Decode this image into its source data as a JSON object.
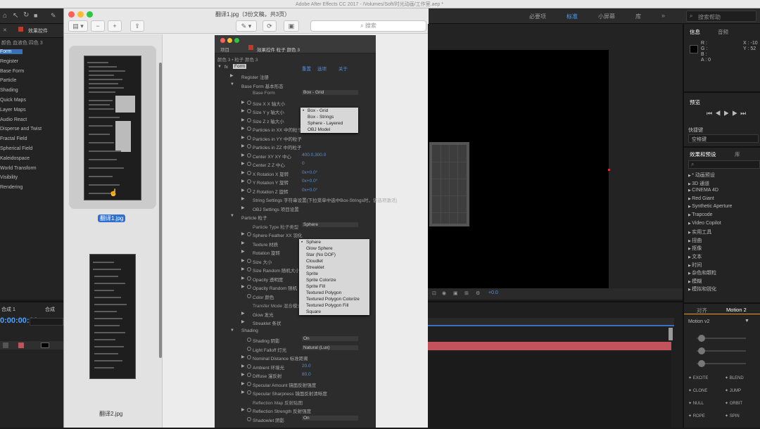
{
  "ae": {
    "window_title": "Adobe After Effects CC 2017 - /Volumes/Soft/时光动画/工作室.aep *",
    "workspaces": [
      "必要项",
      "标准",
      "小屏幕",
      "库"
    ],
    "search_placeholder": "搜索帮助",
    "left": {
      "tab_label": "效果控件",
      "comp_path": "颜色 血液色 四色 3",
      "items": [
        "Form",
        "Register",
        "Base Form",
        "Particle",
        "Shading",
        "Quick Maps",
        "Layer Maps",
        "Audio React",
        "Disperse and Twist",
        "Fractal Field",
        "Spherical Field",
        "Kaleidospace",
        "World Transform",
        "Visibility",
        "Rendering"
      ],
      "bottom_tab": "合成 1",
      "timecode": "0:00:00:00",
      "bottom_tab2": "合成"
    },
    "comp_footer_value": "+0.0",
    "right": {
      "info_tab": "信息",
      "audio_tab": "音频",
      "info_lines": [
        "R :",
        "G :",
        "B :",
        "A : 0"
      ],
      "xy": [
        "X : -10",
        "Y : 52"
      ],
      "preview_title": "预览",
      "shortcut_label": "快捷键",
      "shortcut_value": "空格键",
      "effects_tab": "效果和预设",
      "lib_tab": "库",
      "effects": [
        "* 动画预设",
        "3D 通道",
        "CINEMA 4D",
        "Red Giant",
        "Synthetic Aperture",
        "Trapcode",
        "Video Copilot",
        "实用工具",
        "扭曲",
        "抠像",
        "文本",
        "时间",
        "杂色和颗粒",
        "模糊",
        "模拟和锐化"
      ],
      "align_tab": "对齐",
      "motion_tab": "Motion 2",
      "motion_dropdown": "Motion v2",
      "motion_buttons": [
        "EXCITE",
        "BLEND",
        "CLONE",
        "JUMP",
        "NULL",
        "ORBIT",
        "ROPE",
        "SPIN"
      ]
    }
  },
  "preview": {
    "title": "翻译1.jpg（3份文稿，共3页）",
    "search_placeholder": "搜索",
    "thumbs": [
      {
        "name": "翻译1.jpg",
        "selected": true
      },
      {
        "name": "翻译2.jpg",
        "selected": false
      }
    ]
  },
  "doc": {
    "tabs": [
      "项目",
      "效果控件 粒子 颜色 3"
    ],
    "breadcrumb": "颜色 3 • 粒子 颜色 3",
    "fx_name": "Form",
    "fx_buttons": [
      "重置",
      "选项",
      "关于"
    ],
    "rows": [
      {
        "label": "Register 注册",
        "indent": 2,
        "tri": true
      },
      {
        "label": "Base Form 基本形态",
        "indent": 2,
        "tri": true,
        "open": true
      },
      {
        "label": "Base Form",
        "indent": 4,
        "value": "Box - Grid"
      },
      {
        "label": "Size X  X 轴大小",
        "indent": 4,
        "tri": true,
        "sw": true
      },
      {
        "label": "Size Y  y 轴大小",
        "indent": 4,
        "tri": true,
        "sw": true
      },
      {
        "label": "Size Z  z 轴大小",
        "indent": 4,
        "tri": true,
        "sw": true
      },
      {
        "label": "Particles in XX 中的粒子",
        "indent": 4,
        "tri": true,
        "sw": true
      },
      {
        "label": "Particles in YY 中的粒子",
        "indent": 4,
        "tri": true,
        "sw": true
      },
      {
        "label": "Particles in ZZ 中的粒子",
        "indent": 4,
        "tri": true,
        "sw": true
      },
      {
        "label": "Center XY XY 中心",
        "indent": 4,
        "tri": true,
        "sw": true,
        "value": "400.0,300.0"
      },
      {
        "label": "Center Z  Z 中心",
        "indent": 4,
        "tri": true,
        "sw": true,
        "value": "0"
      },
      {
        "label": "X Rotation X 旋转",
        "indent": 4,
        "tri": true,
        "sw": true,
        "value": "0x+0.0°"
      },
      {
        "label": "Y Rotation Y 旋转",
        "indent": 4,
        "tri": true,
        "sw": true,
        "value": "0x+0.0°"
      },
      {
        "label": "Z Rotation Z 旋转",
        "indent": 4,
        "tri": true,
        "sw": true,
        "value": "0x+0.0°"
      },
      {
        "label": "String Settings 字符串设置(下拉菜单中选中Box-Strings时，该选项激活)",
        "indent": 4,
        "tri": true
      },
      {
        "label": "OBJ Settings 项目设置",
        "indent": 4,
        "tri": true
      },
      {
        "label": "Particle 粒子",
        "indent": 2,
        "tri": true,
        "open": true
      },
      {
        "label": "Particle Type 粒子类型",
        "indent": 4,
        "value": "Sphere"
      },
      {
        "label": "Sphere Feather XX 羽化",
        "indent": 4,
        "tri": true,
        "sw": true
      },
      {
        "label": "Texture 材质",
        "indent": 4,
        "tri": true
      },
      {
        "label": "Rotation 旋转",
        "indent": 4,
        "tri": true
      },
      {
        "label": "Size 大小",
        "indent": 4,
        "tri": true,
        "sw": true
      },
      {
        "label": "Size Random 随机大小",
        "indent": 4,
        "tri": true,
        "sw": true
      },
      {
        "label": "Opacity 透明度",
        "indent": 4,
        "tri": true,
        "sw": true
      },
      {
        "label": "Opacity Random 随机",
        "indent": 4,
        "tri": true,
        "sw": true
      },
      {
        "label": "Color 颜色",
        "indent": 4,
        "sw": true
      },
      {
        "label": "Transfer Mode 混合模式",
        "indent": 4
      },
      {
        "label": "Glow 发光",
        "indent": 4,
        "tri": true
      },
      {
        "label": "Streaklet 条状",
        "indent": 4,
        "tri": true
      },
      {
        "label": "Shading",
        "indent": 2,
        "tri": true,
        "open": true
      },
      {
        "label": "Shading 阴影",
        "indent": 4,
        "sw": true,
        "value": "On"
      },
      {
        "label": "Light Falloff 灯光",
        "indent": 4,
        "sw": true,
        "value": "Natural (Lux)"
      },
      {
        "label": "Nominal Distance 标准距离",
        "indent": 4,
        "tri": true,
        "sw": true
      },
      {
        "label": "Ambient 环境光",
        "indent": 4,
        "tri": true,
        "sw": true,
        "value": "20.0"
      },
      {
        "label": "Diffuse 漫反射",
        "indent": 4,
        "tri": true,
        "sw": true,
        "value": "80.0"
      },
      {
        "label": "Specular Amount 镜面反射强度",
        "indent": 4,
        "tri": true,
        "sw": true
      },
      {
        "label": "Specular Sharpness 镜面反射清晰度",
        "indent": 4,
        "tri": true,
        "sw": true
      },
      {
        "label": "Reflection Map 反射贴图",
        "indent": 4
      },
      {
        "label": "Reflection Strength 反射强度",
        "indent": 4,
        "tri": true,
        "sw": true
      },
      {
        "label": "Shadowlet 阴影",
        "indent": 4,
        "sw": true,
        "value": "On"
      }
    ],
    "base_form_options": [
      "Box - Grid",
      "Box - Strings",
      "Sphere - Layered",
      "OBJ Model"
    ],
    "particle_type_options": [
      "Sphere",
      "Glow Sphere",
      "Star (No DOF)",
      "Cloudlet",
      "Streaklet",
      "Sprite",
      "Sprite Colorize",
      "Sprite Fill",
      "Textured Polygon",
      "Textured Polygon Colorize",
      "Textured Polygon Fill",
      "Square"
    ]
  },
  "colors": {
    "accent": "#3b6fc6",
    "timeline_bar": "#c4525c",
    "value_blue": "#5b8fd6"
  }
}
